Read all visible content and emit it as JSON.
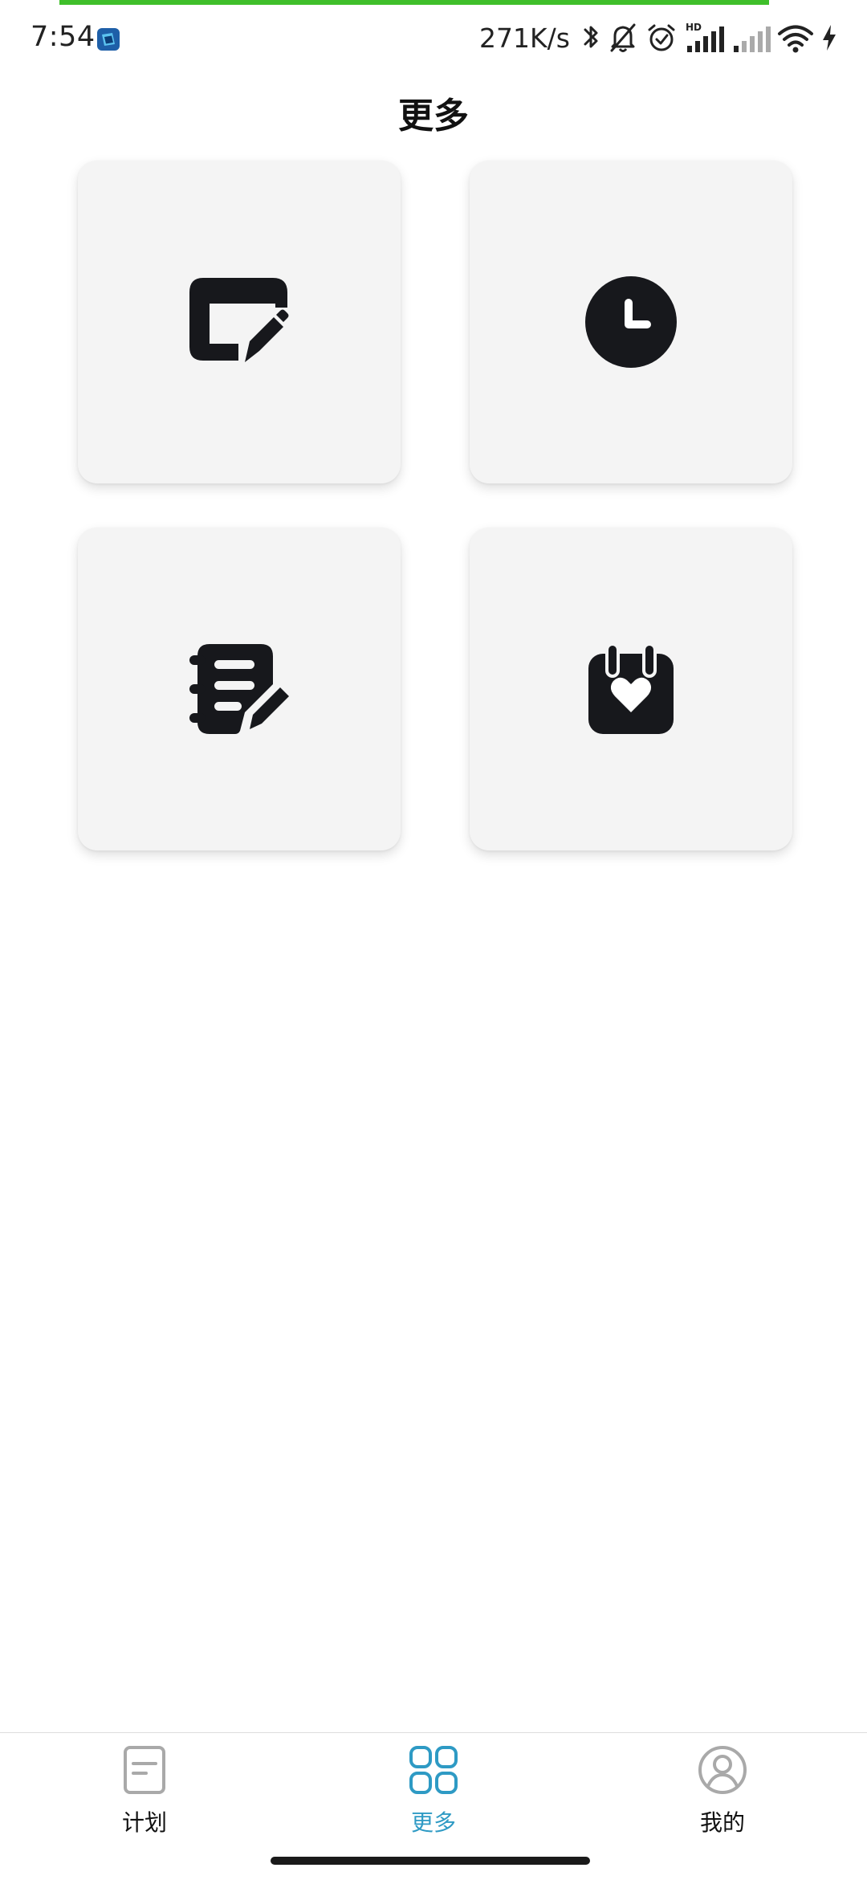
{
  "status_bar": {
    "time": "7:54",
    "net_speed": "271K/s",
    "hd_label": "HD",
    "icons": [
      "app-icon",
      "bluetooth-icon",
      "bell-off-icon",
      "alarm-icon",
      "signal-hd-icon",
      "signal-icon",
      "wifi-icon",
      "charging-icon"
    ],
    "progress_color": "#3fbf2a"
  },
  "page": {
    "title": "更多"
  },
  "grid": {
    "items": [
      {
        "icon": "window-edit-icon"
      },
      {
        "icon": "clock-icon"
      },
      {
        "icon": "notebook-edit-icon"
      },
      {
        "icon": "calendar-heart-icon"
      }
    ]
  },
  "tab_bar": {
    "active_color": "#2e9ac4",
    "tabs": [
      {
        "label": "计划",
        "icon": "document-icon",
        "active": false
      },
      {
        "label": "更多",
        "icon": "grid-icon",
        "active": true
      },
      {
        "label": "我的",
        "icon": "user-circle-icon",
        "active": false
      }
    ]
  }
}
